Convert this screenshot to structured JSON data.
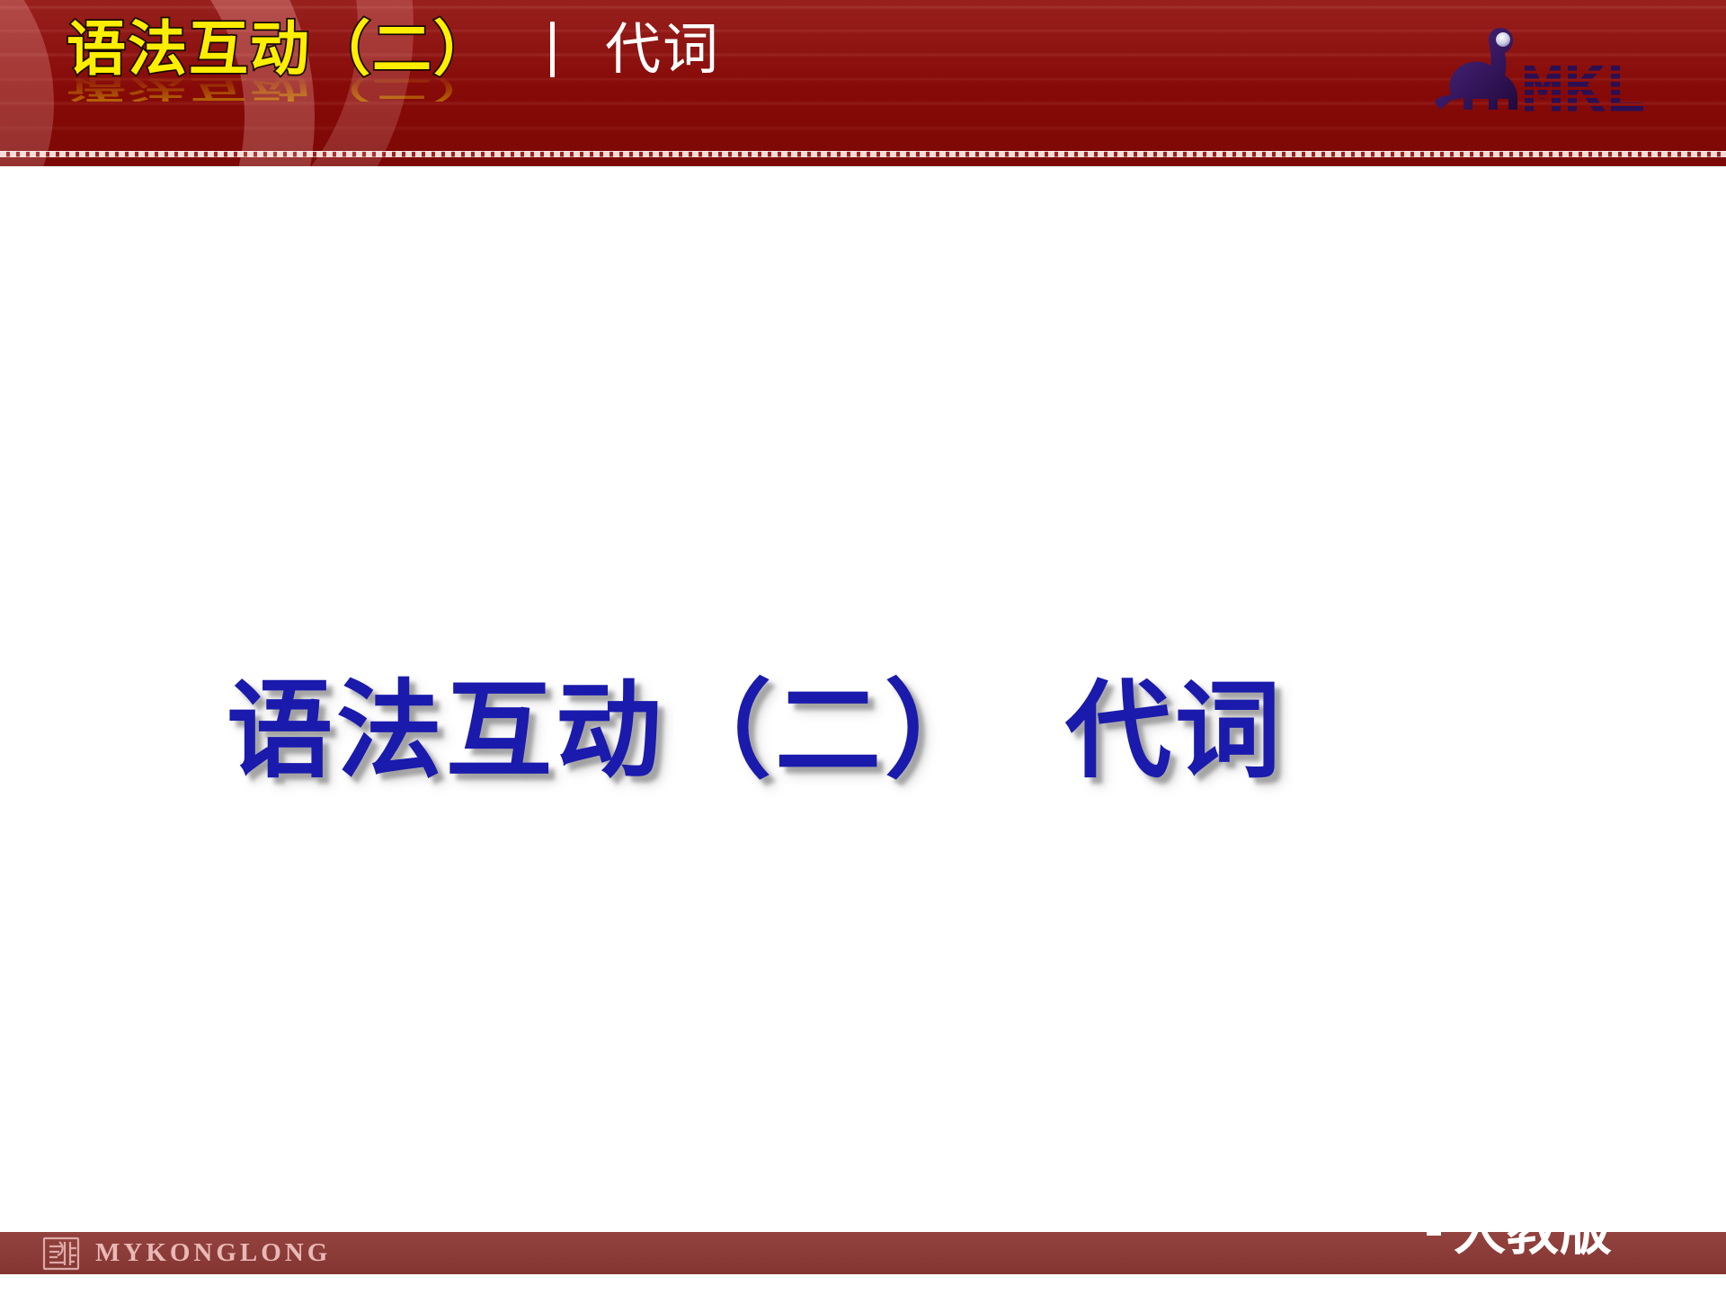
{
  "slide": {
    "background_color": "#ffffff",
    "header": {
      "band_color": "#8d0a07",
      "title_text": "语法互动（二）",
      "title_color": "#ffee00",
      "title_outline_color": "#1a0a05",
      "separator": "|",
      "subtitle_text": "代词",
      "subtitle_color": "#ffffff",
      "divider_color": "#ffebe8",
      "decoration_name": "concentric-rose-swirl"
    },
    "logo": {
      "icon_name": "dinosaur-icon",
      "wordmark": "MKL",
      "color": "#3a1a6e"
    },
    "main": {
      "title_part_1": "语法互动（二）",
      "title_part_2": "代词",
      "title_color": "#1a1aad",
      "shadow_color": "#6e6e6e"
    },
    "footer": {
      "band_color": "#8e3935",
      "seal_icon_name": "seal-stamp-icon",
      "brand_text": "MYKONGLONG",
      "brand_color": "#e9b9b6",
      "edition_bullet": "▪",
      "edition_text": "人教版",
      "edition_color": "#ffffff"
    }
  }
}
